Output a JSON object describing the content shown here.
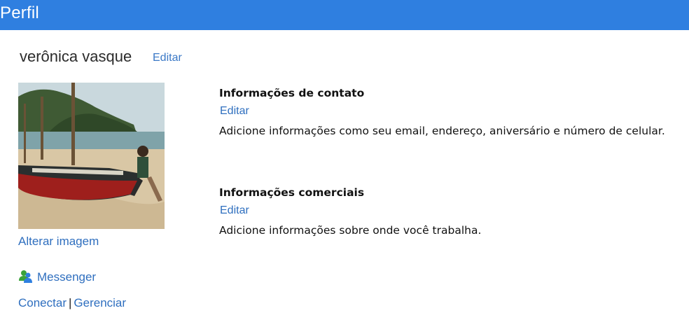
{
  "header": {
    "title": "Perfil"
  },
  "profile": {
    "name": "verônica vasque",
    "edit_label": "Editar",
    "change_image_label": "Alterar imagem"
  },
  "messenger": {
    "label": "Messenger",
    "connect_label": "Conectar",
    "separator": "|",
    "manage_label": "Gerenciar"
  },
  "sections": [
    {
      "title": "Informações de contato",
      "edit_label": "Editar",
      "description": "Adicione informações como seu email, endereço, aniversário e número de celular."
    },
    {
      "title": "Informações comerciais",
      "edit_label": "Editar",
      "description": "Adicione informações sobre onde você trabalha."
    }
  ],
  "colors": {
    "header_bg": "#2f7fe0",
    "link": "#2f6fbf",
    "text": "#111111"
  }
}
